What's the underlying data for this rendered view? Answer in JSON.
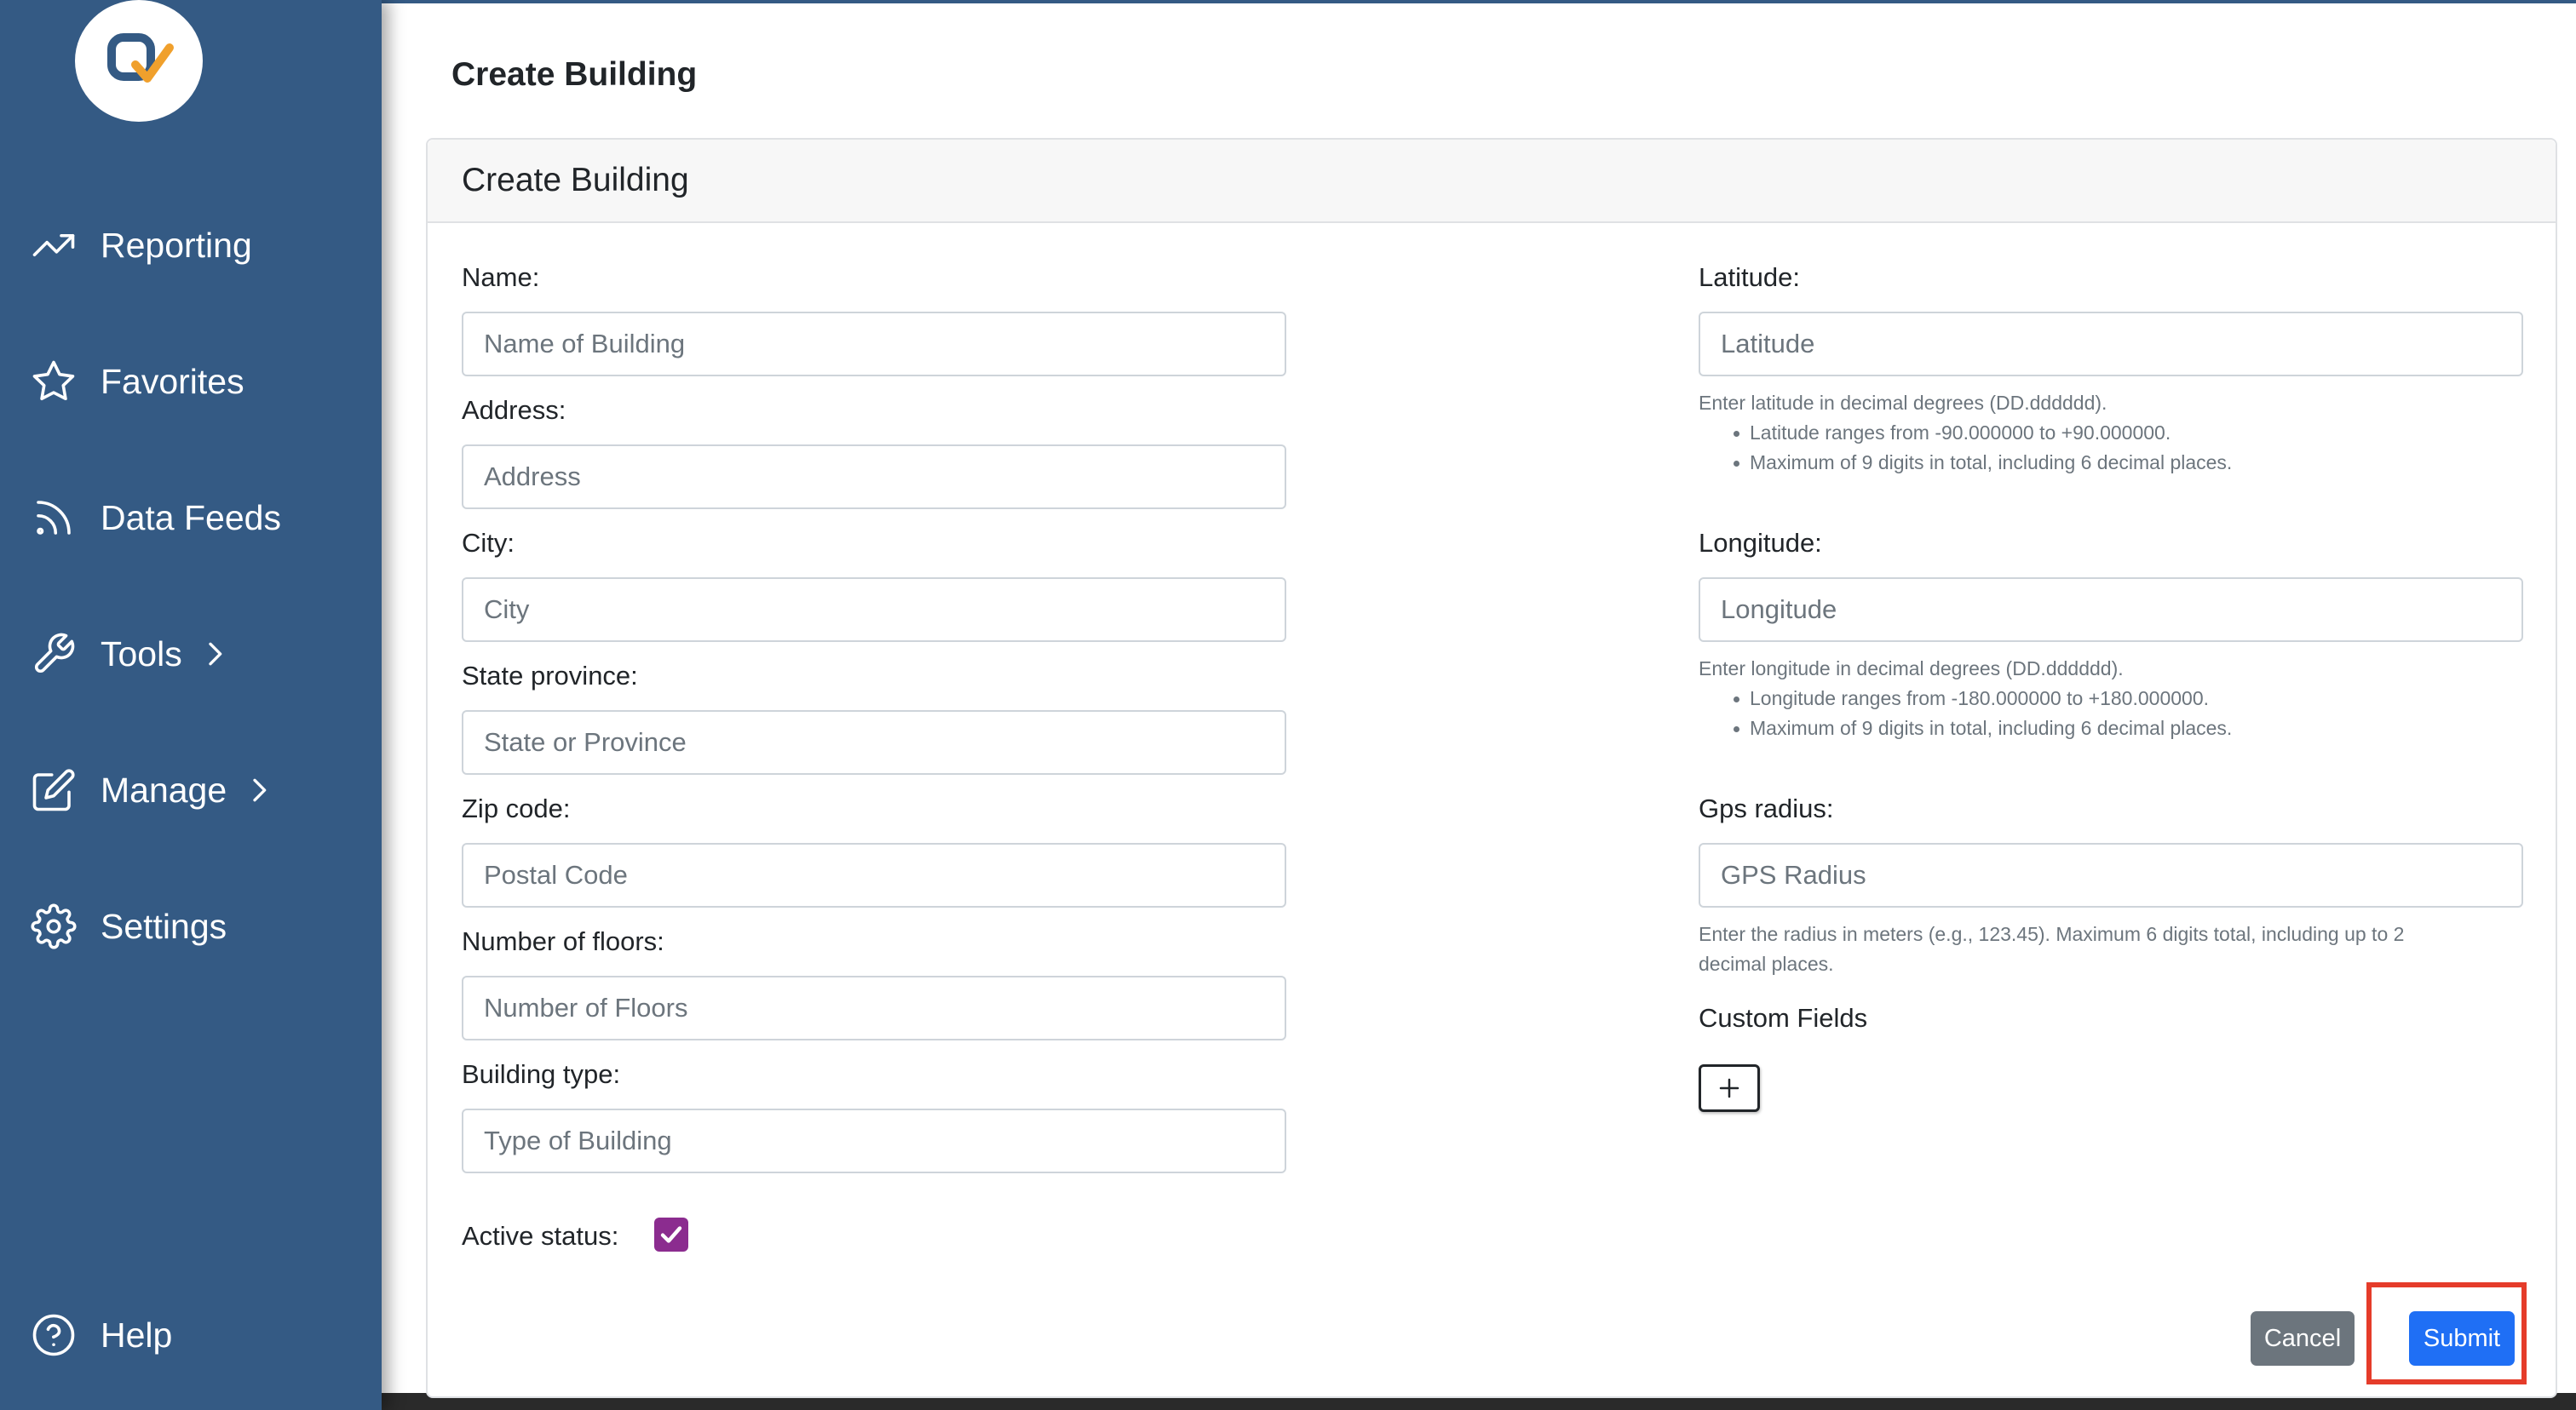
{
  "sidebar": {
    "items": [
      {
        "label": "Reporting",
        "icon": "trending-up-icon"
      },
      {
        "label": "Favorites",
        "icon": "star-icon"
      },
      {
        "label": "Data Feeds",
        "icon": "rss-icon"
      },
      {
        "label": "Tools",
        "icon": "wrench-icon",
        "has_submenu": true
      },
      {
        "label": "Manage",
        "icon": "edit-icon",
        "has_submenu": true
      },
      {
        "label": "Settings",
        "icon": "gear-icon"
      }
    ],
    "help": {
      "label": "Help",
      "icon": "help-circle-icon"
    }
  },
  "page": {
    "title": "Create Building"
  },
  "form": {
    "title": "Create Building",
    "left": {
      "name": {
        "label": "Name:",
        "placeholder": "Name of Building",
        "value": ""
      },
      "address": {
        "label": "Address:",
        "placeholder": "Address",
        "value": ""
      },
      "city": {
        "label": "City:",
        "placeholder": "City",
        "value": ""
      },
      "state": {
        "label": "State province:",
        "placeholder": "State or Province",
        "value": ""
      },
      "zip": {
        "label": "Zip code:",
        "placeholder": "Postal Code",
        "value": ""
      },
      "floors": {
        "label": "Number of floors:",
        "placeholder": "Number of Floors",
        "value": ""
      },
      "type": {
        "label": "Building type:",
        "placeholder": "Type of Building",
        "value": ""
      },
      "active": {
        "label": "Active status:",
        "checked": true
      }
    },
    "right": {
      "latitude": {
        "label": "Latitude:",
        "placeholder": "Latitude",
        "value": "",
        "help": "Enter latitude in decimal degrees (DD.dddddd).",
        "bullets": [
          "Latitude ranges from -90.000000 to +90.000000.",
          "Maximum of 9 digits in total, including 6 decimal places."
        ]
      },
      "longitude": {
        "label": "Longitude:",
        "placeholder": "Longitude",
        "value": "",
        "help": "Enter longitude in decimal degrees (DD.dddddd).",
        "bullets": [
          "Longitude ranges from -180.000000 to +180.000000.",
          "Maximum of 9 digits in total, including 6 decimal places."
        ]
      },
      "gps": {
        "label": "Gps radius:",
        "placeholder": "GPS Radius",
        "value": "",
        "help_line1": "Enter the radius in meters (e.g., 123.45). Maximum 6 digits total, including up to 2",
        "help_line2": "decimal places."
      },
      "custom_fields": {
        "label": "Custom Fields",
        "add_label": "+"
      }
    },
    "actions": {
      "cancel": "Cancel",
      "submit": "Submit"
    }
  },
  "colors": {
    "sidebar": "#345a84",
    "submit": "#1f6ff5",
    "cancel": "#6c757d",
    "checkbox": "#8b2c8f",
    "highlight": "#e53c2a",
    "logo_q": "#345a84",
    "logo_check": "#f0a02c"
  }
}
